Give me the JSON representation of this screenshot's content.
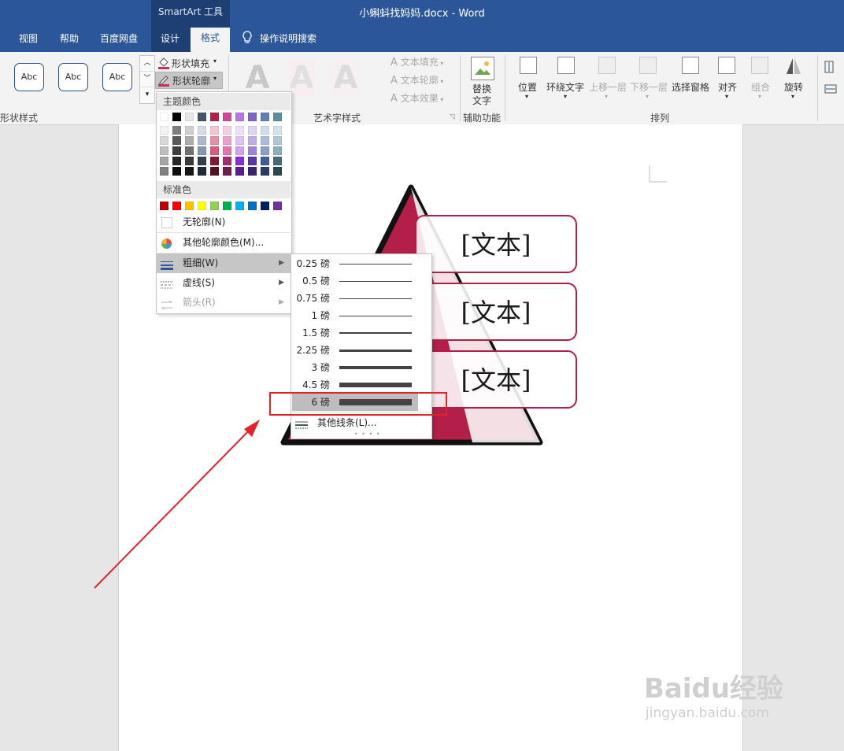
{
  "titlebar": {
    "context_label": "SmartArt 工具",
    "doc_title": "小蝌蚪找妈妈.docx  -  Word"
  },
  "tabs": [
    {
      "label": "视图"
    },
    {
      "label": "帮助"
    },
    {
      "label": "百度网盘"
    },
    {
      "label": "设计"
    },
    {
      "label": "格式"
    },
    {
      "label": "操作说明搜索"
    }
  ],
  "ribbon": {
    "shape_styles": {
      "items": [
        "Abc",
        "Abc",
        "Abc"
      ],
      "group_label": "形状样式"
    },
    "shape_fill": "形状填充",
    "shape_outline": "形状轮廓",
    "wordart": {
      "glyph": "A",
      "text_fill": "文本填充",
      "text_outline": "文本轮廓",
      "text_effects": "文本效果",
      "group_label": "艺术字样式"
    },
    "accessibility": {
      "alt_text": "替换\n文字",
      "alt_text_l1": "替换",
      "alt_text_l2": "文字",
      "group_label": "辅助功能"
    },
    "arrange": {
      "position": "位置",
      "wrap_text": "环绕文字",
      "bring_forward": "上移一层",
      "send_backward": "下移一层",
      "selection_pane": "选择窗格",
      "align": "对齐",
      "group": "组合",
      "rotate": "旋转",
      "group_label": "排列"
    }
  },
  "outline_menu": {
    "theme_colors_header": "主题颜色",
    "theme_colors_top": [
      "#ffffff",
      "#000000",
      "#e7e6e6",
      "#44546a",
      "#b31f49",
      "#d24897",
      "#b776e8",
      "#7b66c8",
      "#5e7dba",
      "#5d8fa0"
    ],
    "theme_colors_shades": [
      [
        "#f2f2f2",
        "#7f7f7f",
        "#d0cece",
        "#d6dce4",
        "#f5c5d3",
        "#f6cde3",
        "#efe0fa",
        "#dcd6f2",
        "#d4dcec",
        "#d3e3e8"
      ],
      [
        "#d8d8d8",
        "#595959",
        "#aeabab",
        "#acb9ca",
        "#ea8ea8",
        "#eda0c9",
        "#e0c1f5",
        "#bcaee5",
        "#adbcd9",
        "#afc8d1"
      ],
      [
        "#bfbfbf",
        "#3f3f3f",
        "#757070",
        "#8496b0",
        "#df587e",
        "#e374af",
        "#d1a3f0",
        "#9c85d8",
        "#8b9fc9",
        "#8baebb"
      ],
      [
        "#a5a5a5",
        "#262626",
        "#3a3838",
        "#333f4f",
        "#861737",
        "#a62b70",
        "#8a2ed9",
        "#5638a8",
        "#3e5d96",
        "#466b77"
      ],
      [
        "#7f7f7f",
        "#0c0c0c",
        "#171616",
        "#222a35",
        "#590f24",
        "#6f1d4b",
        "#5c1b93",
        "#39256f",
        "#293e64",
        "#2e4750"
      ]
    ],
    "standard_colors_header": "标准色",
    "standard_colors": [
      "#c00000",
      "#ff0000",
      "#ffc000",
      "#ffff00",
      "#92d050",
      "#00b050",
      "#00b0f0",
      "#0070c0",
      "#002060",
      "#7030a0"
    ],
    "items": [
      {
        "label": "无轮廓(N)",
        "icon": "no-outline-swatch"
      },
      {
        "label": "其他轮廓颜色(M)...",
        "icon": "color-wheel-icon"
      },
      {
        "label": "粗细(W)",
        "icon": "line-weight-icon",
        "submenu": true,
        "selected": true
      },
      {
        "label": "虚线(S)",
        "icon": "dashes-icon",
        "submenu": true
      },
      {
        "label": "箭头(R)",
        "icon": "arrows-icon",
        "submenu": true,
        "disabled": true
      }
    ]
  },
  "weight_submenu": {
    "weights": [
      {
        "label": "0.25 磅",
        "pt": 0.25
      },
      {
        "label": "0.5 磅",
        "pt": 0.5
      },
      {
        "label": "0.75 磅",
        "pt": 0.75
      },
      {
        "label": "1 磅",
        "pt": 1
      },
      {
        "label": "1.5 磅",
        "pt": 1.5
      },
      {
        "label": "2.25 磅",
        "pt": 2.25
      },
      {
        "label": "3 磅",
        "pt": 3
      },
      {
        "label": "4.5 磅",
        "pt": 4.5
      },
      {
        "label": "6 磅",
        "pt": 6,
        "selected": true
      }
    ],
    "more_lines": "其他线条(L)..."
  },
  "document": {
    "smartart_texts": [
      "[文本]",
      "[文本]",
      "[文本]"
    ],
    "pyramid_fill": "#b31f49"
  },
  "watermark": {
    "brand": "Baidu经验",
    "url": "jingyan.baidu.com"
  }
}
